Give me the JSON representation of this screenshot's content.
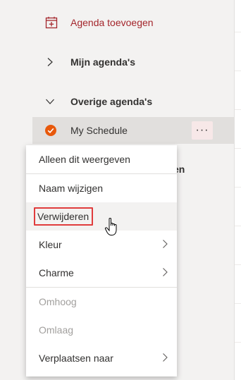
{
  "sidebar": {
    "add_agenda_label": "Agenda toevoegen",
    "my_calendars_label": "Mijn agenda's",
    "other_calendars_label": "Overige agenda's",
    "schedule_label": "My Schedule",
    "more_label": "···",
    "peek_text": "en"
  },
  "context_menu": {
    "items": [
      {
        "label": "Alleen dit weergeven"
      },
      {
        "label": "Naam wijzigen"
      },
      {
        "label": "Verwijderen"
      },
      {
        "label": "Kleur"
      },
      {
        "label": "Charme"
      },
      {
        "label": "Omhoog"
      },
      {
        "label": "Omlaag"
      },
      {
        "label": "Verplaatsen naar"
      }
    ]
  },
  "colors": {
    "accent_red": "#a4262c",
    "schedule_dot": "#e8590c",
    "highlight_border": "#e03c3c"
  },
  "icons": {
    "add": "calendar-add-icon",
    "expand": "chevron-right-icon",
    "collapse": "chevron-down-icon",
    "check": "check-circle-icon",
    "more": "more-icon",
    "cursor": "hand-pointer-icon"
  }
}
